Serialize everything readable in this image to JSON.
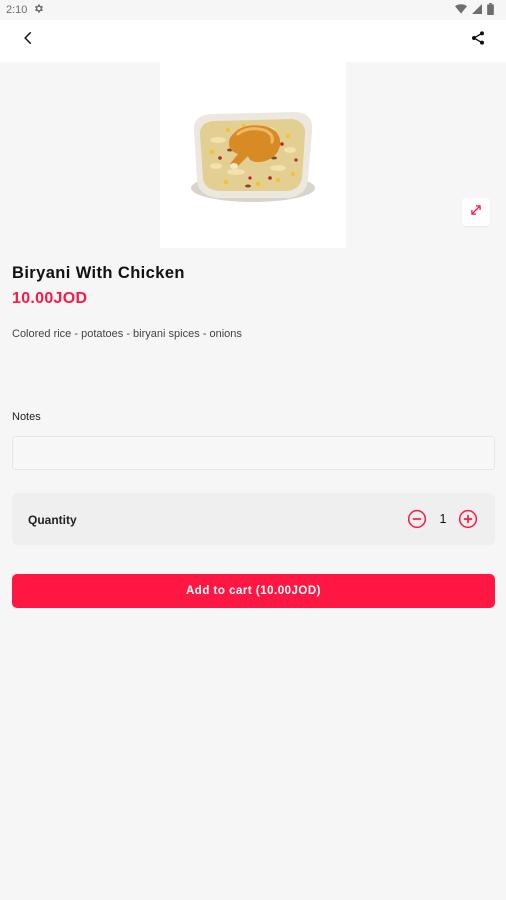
{
  "status_bar": {
    "time": "2:10",
    "icons": [
      "gear-icon",
      "wifi-icon",
      "signal-icon",
      "battery-icon"
    ]
  },
  "toolbar": {
    "back_icon": "chevron-left-icon",
    "share_icon": "share-icon"
  },
  "product": {
    "name": "Biryani With Chicken",
    "price": "10.00JOD",
    "description": "Colored rice - potatoes - biryani spices - onions",
    "expand_icon": "expand-icon"
  },
  "notes": {
    "label": "Notes",
    "value": "",
    "placeholder": ""
  },
  "quantity": {
    "label": "Quantity",
    "value": "1",
    "minus_icon": "minus-circle-icon",
    "plus_icon": "plus-circle-icon"
  },
  "cart": {
    "button_label": "Add to cart (10.00JOD)"
  },
  "colors": {
    "accent": "#ff1744",
    "background": "#f6f6f6",
    "surface": "#ffffff"
  }
}
